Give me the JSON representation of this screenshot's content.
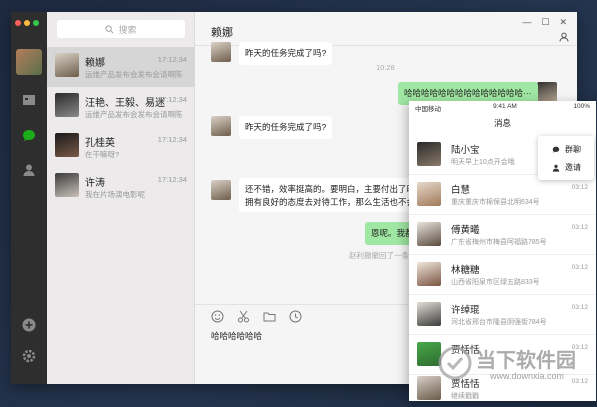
{
  "search": {
    "placeholder": "搜索"
  },
  "contacts": [
    {
      "name": "赖娜",
      "time": "17:12:34",
      "preview": "运维产品发布会发布会请啊陈"
    },
    {
      "name": "汪艳、王毅、易迷",
      "time": "17:12:34",
      "preview": "运维产品发布会发布会请啊陈"
    },
    {
      "name": "孔桂英",
      "time": "17:12:34",
      "preview": "在干嘛呀?"
    },
    {
      "name": "许涛",
      "time": "17:12:34",
      "preview": "我在片场演电影呢"
    }
  ],
  "chat": {
    "title": "赖娜",
    "m1": "昨天的任务完成了吗?",
    "t1": "10:28",
    "m2": "哈哈哈哈哈哈哈哈哈哈哈哈哈哈···",
    "m3": "昨天的任务完成了吗?",
    "m4a": "还不错，效率挺高的。要明白，主要付出了时",
    "m4b": "拥有良好的态度去对待工作，那么生活也不会",
    "m5": "恩呢。我都明",
    "sys": "赵利撤撤回了一条",
    "input": "哈哈哈哈哈哈"
  },
  "window_controls": {
    "min": "—",
    "max": "☐",
    "close": "✕"
  },
  "phone": {
    "carrier": "中国移动",
    "time": "9:41 AM",
    "battery": "100%",
    "title": "消息",
    "rows": [
      {
        "name": "陆小宝",
        "preview": "明天早上10点开会哦",
        "time": ""
      },
      {
        "name": "白慧",
        "preview": "重庆重庆市棉保县北明634号",
        "time": "03:12"
      },
      {
        "name": "傅黄曦",
        "preview": "广东省梅州市梅县阿福路785号",
        "time": "03:12"
      },
      {
        "name": "林糖糖",
        "preview": "山西省阳泉市区绿五路833号",
        "time": "03:12"
      },
      {
        "name": "许绰琨",
        "preview": "河北省邢台市隆县阴强街784号",
        "time": "03:12"
      },
      {
        "name": "贾恬恬",
        "preview": "",
        "time": "03:12"
      },
      {
        "name": "贾恬恬",
        "preview": "继续戳戳",
        "time": "03:12"
      }
    ],
    "popup": {
      "group": "群聊",
      "invite": "邀请"
    }
  },
  "watermark": {
    "cn": "当下软件园",
    "url": "www.downxia.com"
  },
  "colors": {
    "accent_green": "#9fe7a2",
    "sidebar": "#2e2e2e",
    "chat_icon": "#1aad19"
  }
}
